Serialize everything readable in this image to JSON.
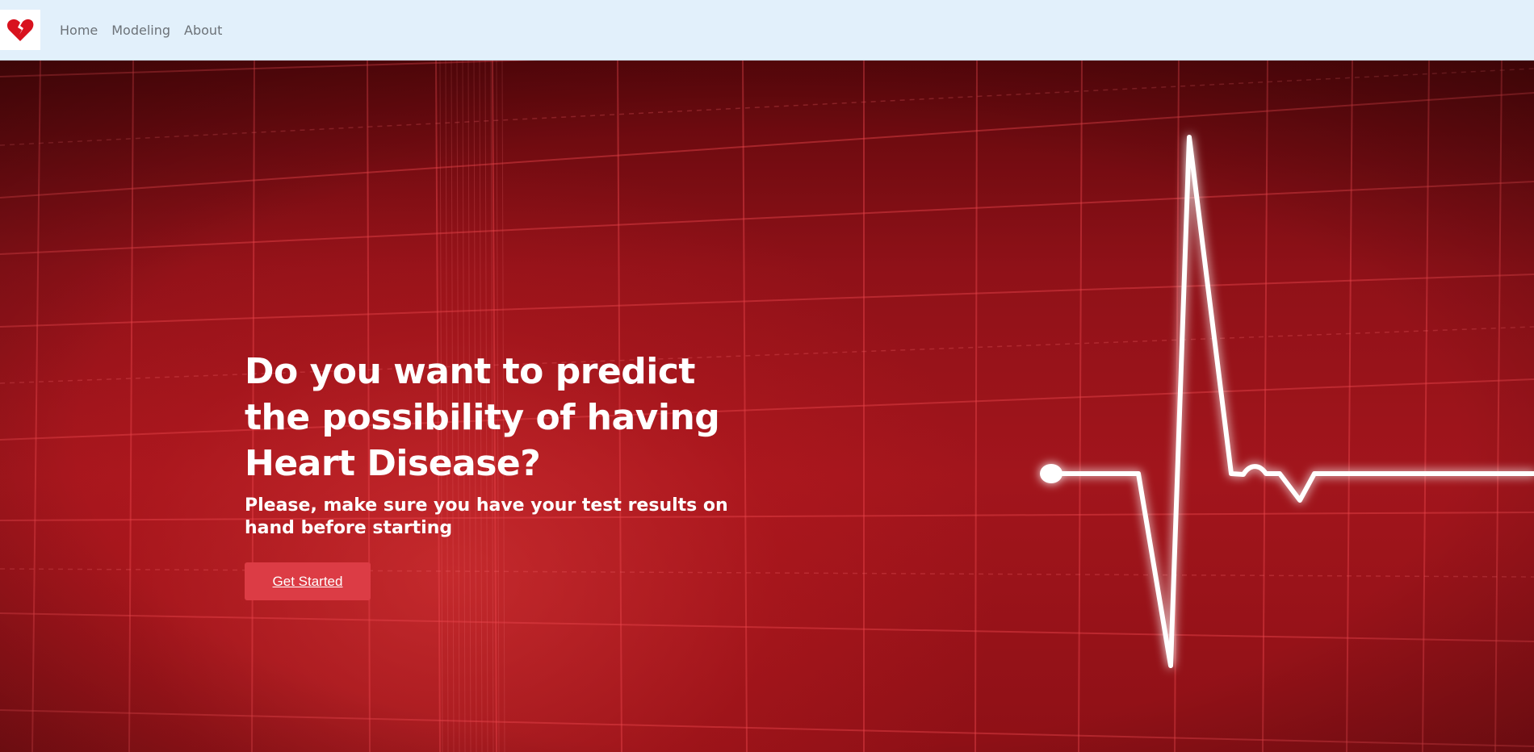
{
  "nav": {
    "logo_icon": "broken-heart-icon",
    "links": [
      {
        "label": "Home"
      },
      {
        "label": "Modeling"
      },
      {
        "label": "About"
      }
    ]
  },
  "hero": {
    "title": "Do you want to predict the possibility of having Heart Disease?",
    "subtitle": "Please, make sure you have your test results on hand before starting",
    "cta_label": "Get Started",
    "background": "ecg-heartbeat-grid"
  },
  "colors": {
    "navbar_bg": "#e2f0fb",
    "hero_red": "#a2151c",
    "cta": "#dc3c45",
    "text_light": "#ffffff",
    "nav_text": "#6c7278"
  }
}
